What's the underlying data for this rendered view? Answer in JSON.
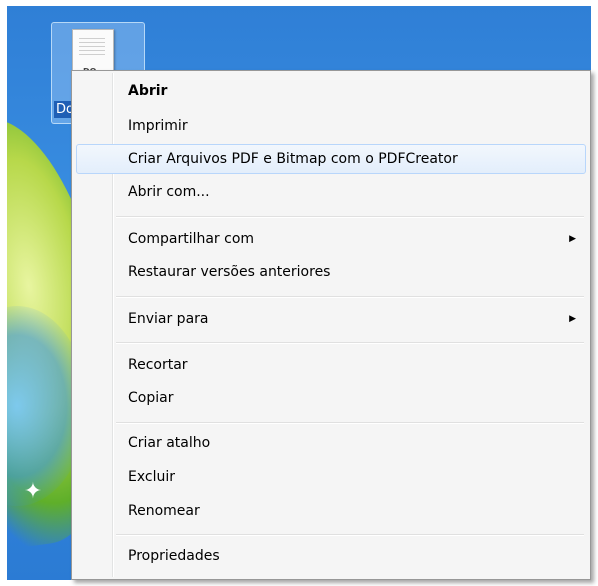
{
  "desktop_icon": {
    "label": "Docu",
    "doc_badge": "DO"
  },
  "sparkle_glyph": "✦",
  "context_menu": {
    "items": [
      {
        "label": "Abrir",
        "bold": true
      },
      {
        "label": "Imprimir"
      },
      {
        "label": "Criar Arquivos PDF e Bitmap com o PDFCreator",
        "highlighted": true
      },
      {
        "label": "Abrir com..."
      },
      {
        "label": "Compartilhar com",
        "submenu": true
      },
      {
        "label": "Restaurar versões anteriores"
      },
      {
        "label": "Enviar para",
        "submenu": true
      },
      {
        "label": "Recortar"
      },
      {
        "label": "Copiar"
      },
      {
        "label": "Criar atalho"
      },
      {
        "label": "Excluir"
      },
      {
        "label": "Renomear"
      },
      {
        "label": "Propriedades"
      }
    ],
    "submenu_arrow": "▶"
  },
  "colors": {
    "menu_background": "#f5f5f5",
    "highlight_border": "#b8d6fb",
    "desktop_blue": "#2f7fd6"
  }
}
